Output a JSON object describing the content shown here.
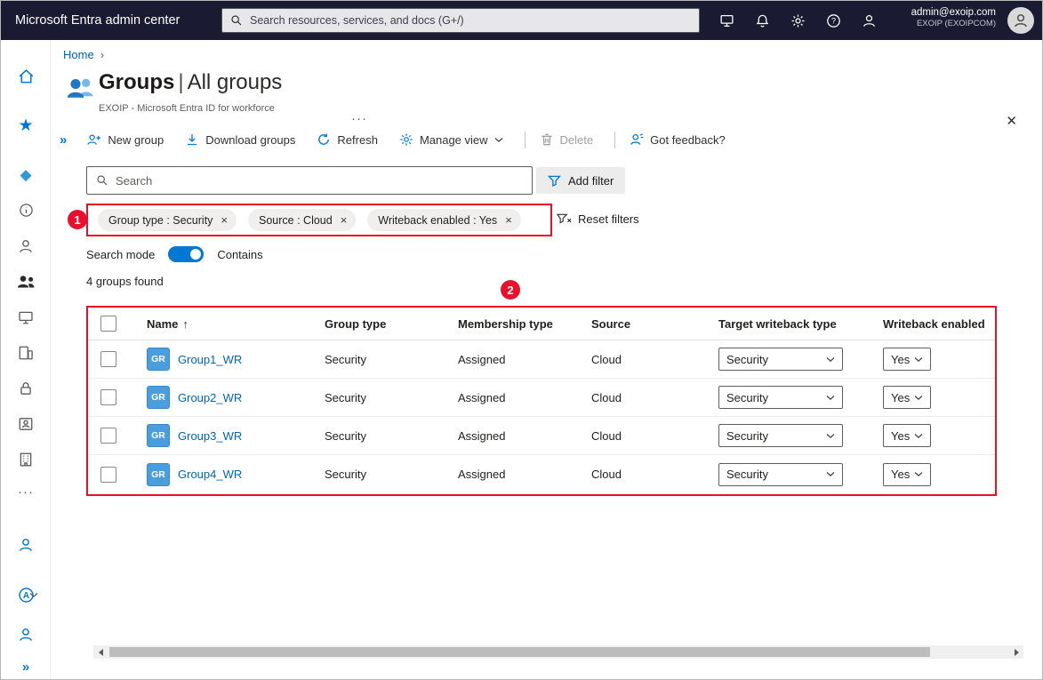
{
  "colors": {
    "accent": "#0078d4",
    "link": "#0065b3",
    "annotation_red": "#e81123",
    "topbar_bg": "#1b1a33",
    "avatar_blue": "#4a9edd"
  },
  "topbar": {
    "title": "Microsoft Entra admin center",
    "search_placeholder": "Search resources, services, and docs (G+/)",
    "account_email": "admin@exoip.com",
    "account_tenant": "EXOIP (EXOIPCOM)"
  },
  "breadcrumb": {
    "home": "Home",
    "separator": "›"
  },
  "page": {
    "title_primary": "Groups",
    "title_separator": "|",
    "title_secondary": "All groups",
    "subtitle": "EXOIP - Microsoft Entra ID for workforce",
    "more": "···",
    "close": "✕"
  },
  "commandbar": {
    "expand": "»",
    "new_group": "New group",
    "download_groups": "Download groups",
    "refresh": "Refresh",
    "manage_view": "Manage view",
    "delete": "Delete",
    "feedback": "Got feedback?"
  },
  "filterbar": {
    "search_placeholder": "Search",
    "add_filter": "Add filter",
    "reset_filters": "Reset filters",
    "chips": [
      {
        "label": "Group type : Security",
        "close": "×"
      },
      {
        "label": "Source : Cloud",
        "close": "×"
      },
      {
        "label": "Writeback enabled : Yes",
        "close": "×"
      }
    ]
  },
  "search_mode": {
    "label": "Search mode",
    "value": "Contains",
    "enabled": true
  },
  "results": {
    "count": "4 groups found"
  },
  "annotations": {
    "badge_1": "1",
    "badge_2": "2"
  },
  "rail": {
    "ellipsis": "···",
    "expand": "»",
    "star": "★",
    "diamond": "◆"
  },
  "table": {
    "headers": {
      "name": "Name",
      "sort": "↑",
      "group_type": "Group type",
      "membership_type": "Membership type",
      "source": "Source",
      "target_writeback_type": "Target writeback type",
      "writeback_enabled": "Writeback enabled"
    },
    "rows": [
      {
        "avatar": "GR",
        "name": "Group1_WR",
        "group_type": "Security",
        "membership_type": "Assigned",
        "source": "Cloud",
        "target_writeback_type": "Security",
        "writeback_enabled": "Yes"
      },
      {
        "avatar": "GR",
        "name": "Group2_WR",
        "group_type": "Security",
        "membership_type": "Assigned",
        "source": "Cloud",
        "target_writeback_type": "Security",
        "writeback_enabled": "Yes"
      },
      {
        "avatar": "GR",
        "name": "Group3_WR",
        "group_type": "Security",
        "membership_type": "Assigned",
        "source": "Cloud",
        "target_writeback_type": "Security",
        "writeback_enabled": "Yes"
      },
      {
        "avatar": "GR",
        "name": "Group4_WR",
        "group_type": "Security",
        "membership_type": "Assigned",
        "source": "Cloud",
        "target_writeback_type": "Security",
        "writeback_enabled": "Yes"
      }
    ]
  }
}
